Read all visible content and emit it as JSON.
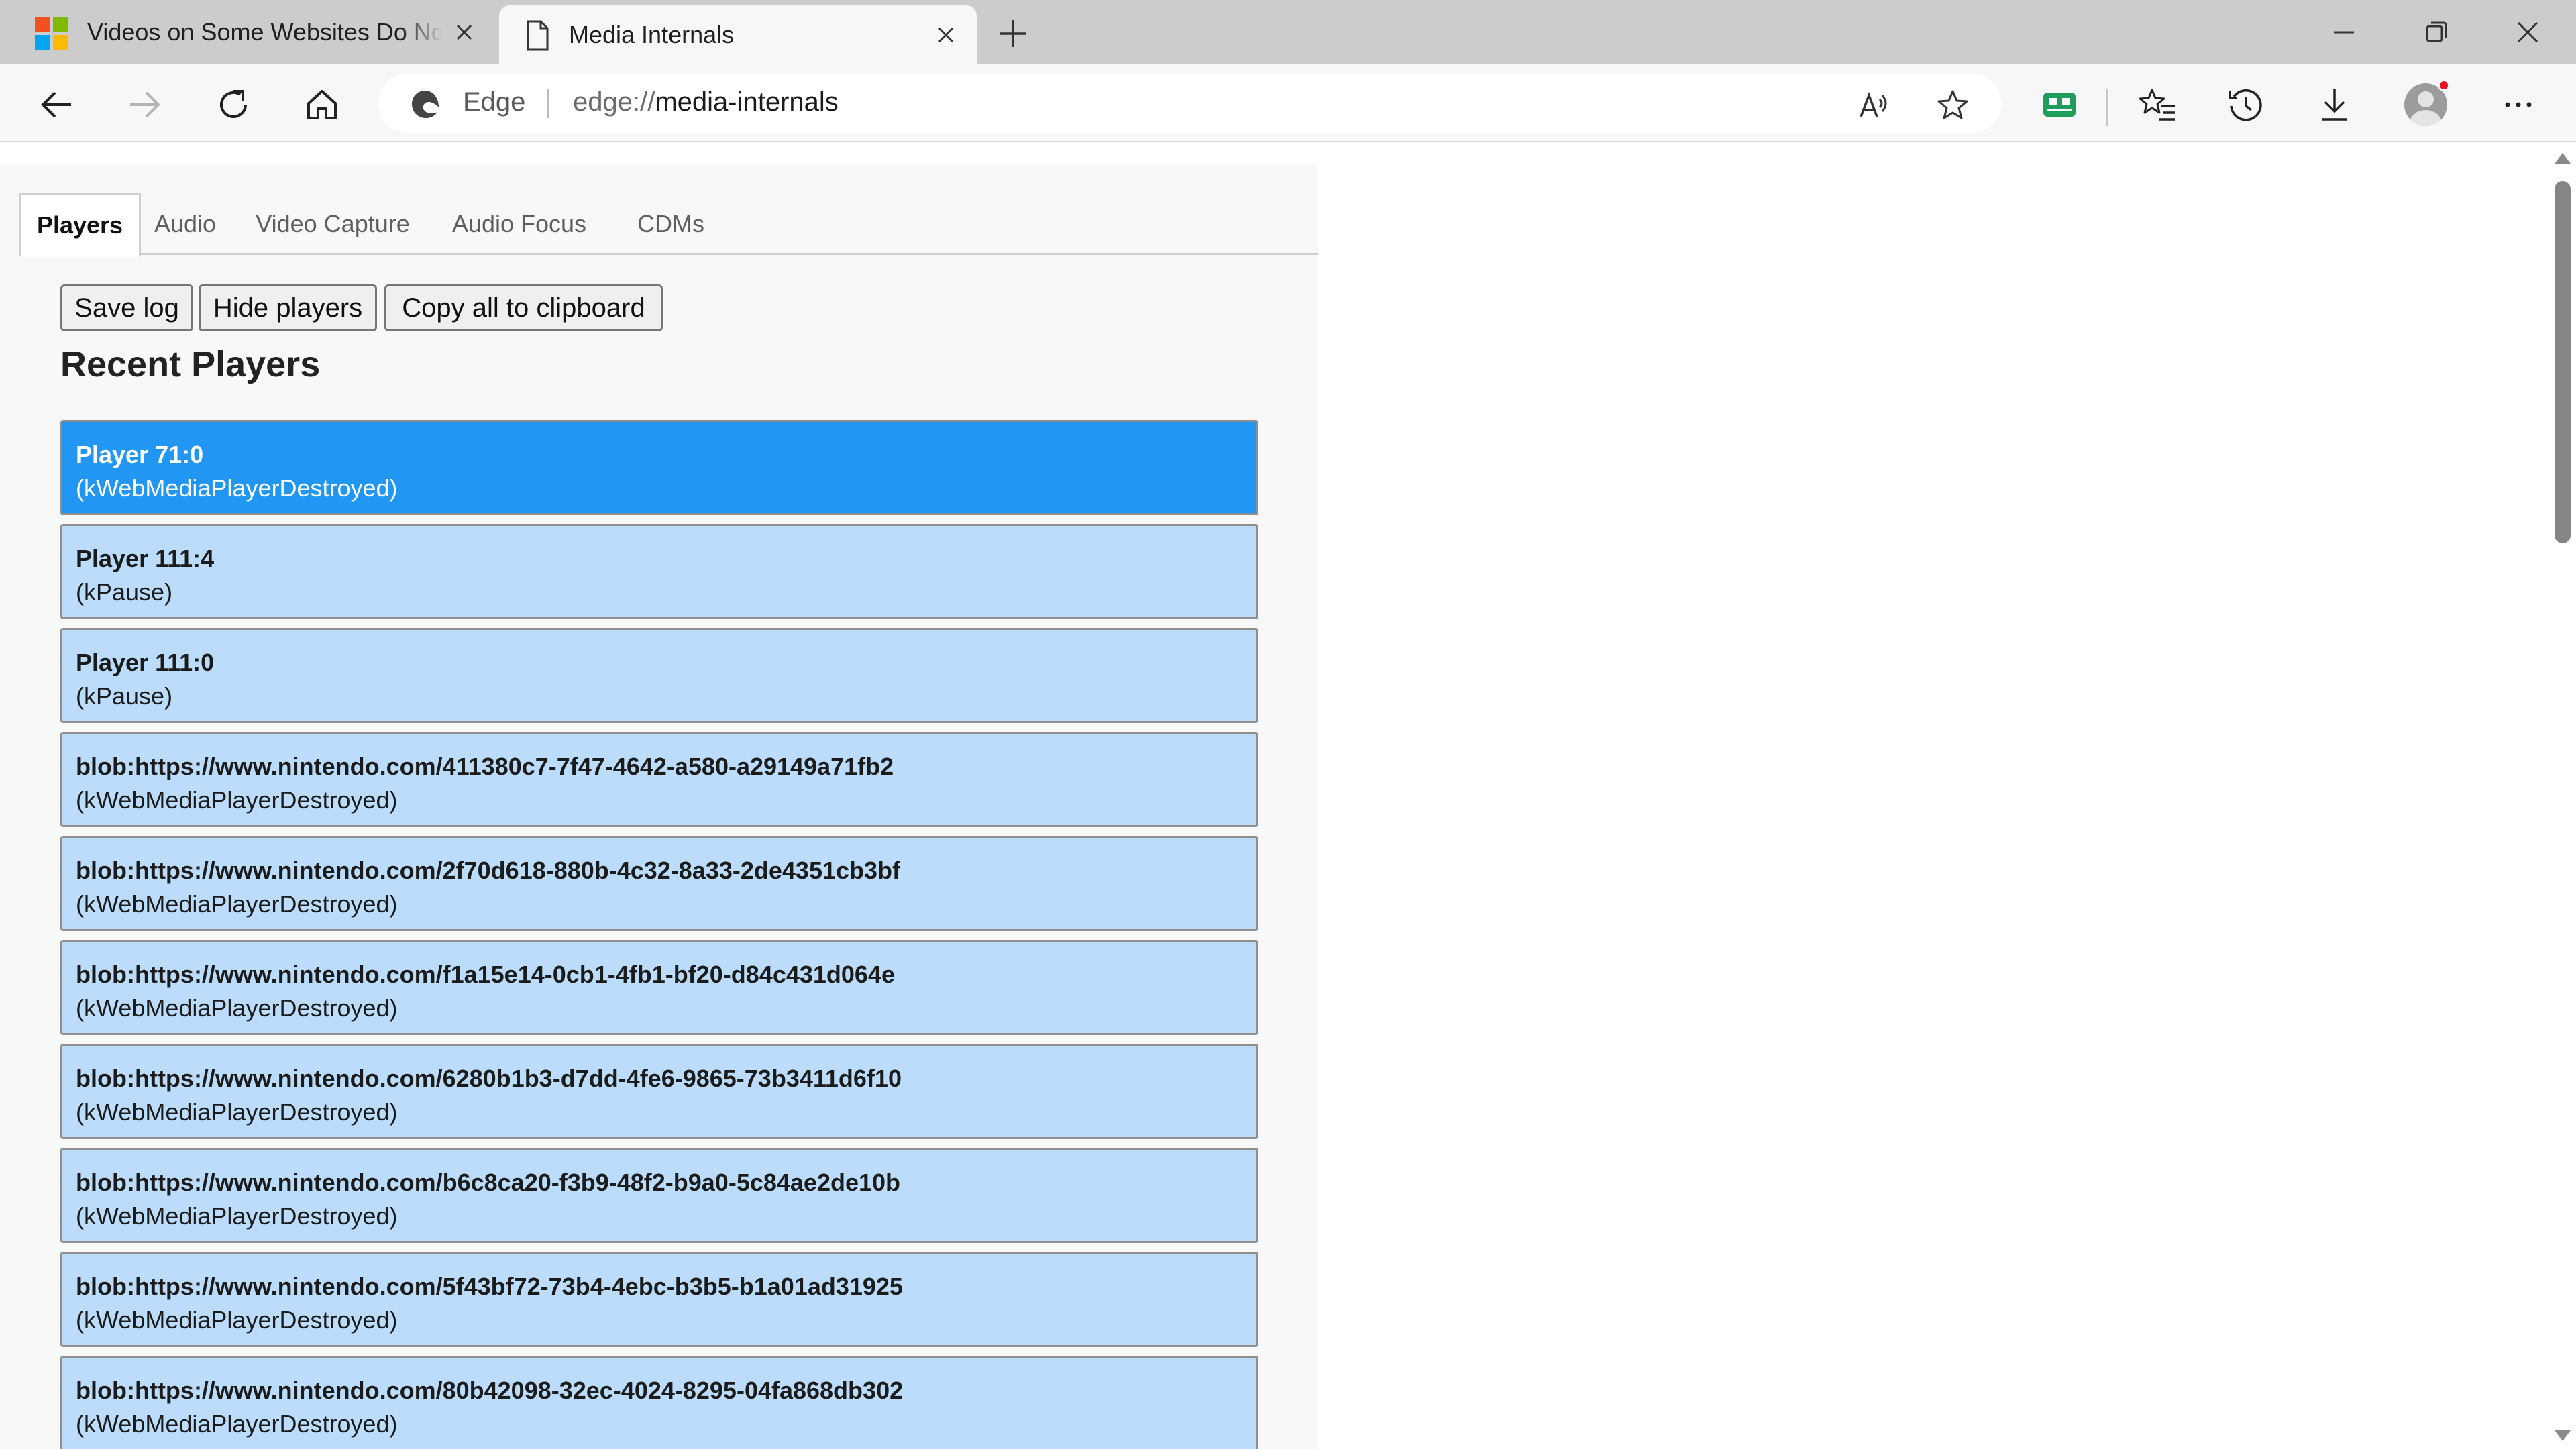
{
  "browser": {
    "tabs": [
      {
        "title": "Videos on Some Websites Do Not Play",
        "favicon": "microsoft-logo-icon",
        "active": false
      },
      {
        "title": "Media Internals",
        "favicon": "page-icon",
        "active": true
      }
    ],
    "address": {
      "site_label": "Edge",
      "url_scheme": "edge://",
      "url_path": "media-internals"
    },
    "icons": {
      "back": "back-arrow-icon",
      "forward": "forward-arrow-icon",
      "refresh": "refresh-icon",
      "home": "home-icon",
      "read_aloud": "read-aloud-icon",
      "favorite": "star-icon",
      "extension": "extension-icon",
      "favorites": "favorites-icon",
      "history": "history-icon",
      "downloads": "download-icon",
      "profile": "profile-avatar",
      "more": "more-icon"
    },
    "accent_colors": {
      "selected_player": "#2196f3",
      "player": "#bbddfb",
      "extension_icon": "#1e9e5a",
      "profile_badge": "#e81123"
    }
  },
  "media_internals": {
    "tabs": [
      "Players",
      "Audio",
      "Video Capture",
      "Audio Focus",
      "CDMs"
    ],
    "active_tab": "Players",
    "buttons": {
      "save_log": "Save log",
      "hide_players": "Hide players",
      "copy_all": "Copy all to clipboard"
    },
    "section_title": "Recent Players",
    "players": [
      {
        "name": "Player 71:0",
        "state": "(kWebMediaPlayerDestroyed)",
        "selected": true
      },
      {
        "name": "Player 111:4",
        "state": "(kPause)",
        "selected": false
      },
      {
        "name": "Player 111:0",
        "state": "(kPause)",
        "selected": false
      },
      {
        "name": "blob:https://www.nintendo.com/411380c7-7f47-4642-a580-a29149a71fb2",
        "state": "(kWebMediaPlayerDestroyed)",
        "selected": false
      },
      {
        "name": "blob:https://www.nintendo.com/2f70d618-880b-4c32-8a33-2de4351cb3bf",
        "state": "(kWebMediaPlayerDestroyed)",
        "selected": false
      },
      {
        "name": "blob:https://www.nintendo.com/f1a15e14-0cb1-4fb1-bf20-d84c431d064e",
        "state": "(kWebMediaPlayerDestroyed)",
        "selected": false
      },
      {
        "name": "blob:https://www.nintendo.com/6280b1b3-d7dd-4fe6-9865-73b3411d6f10",
        "state": "(kWebMediaPlayerDestroyed)",
        "selected": false
      },
      {
        "name": "blob:https://www.nintendo.com/b6c8ca20-f3b9-48f2-b9a0-5c84ae2de10b",
        "state": "(kWebMediaPlayerDestroyed)",
        "selected": false
      },
      {
        "name": "blob:https://www.nintendo.com/5f43bf72-73b4-4ebc-b3b5-b1a01ad31925",
        "state": "(kWebMediaPlayerDestroyed)",
        "selected": false
      },
      {
        "name": "blob:https://www.nintendo.com/80b42098-32ec-4024-8295-04fa868db302",
        "state": "(kWebMediaPlayerDestroyed)",
        "selected": false
      }
    ]
  }
}
